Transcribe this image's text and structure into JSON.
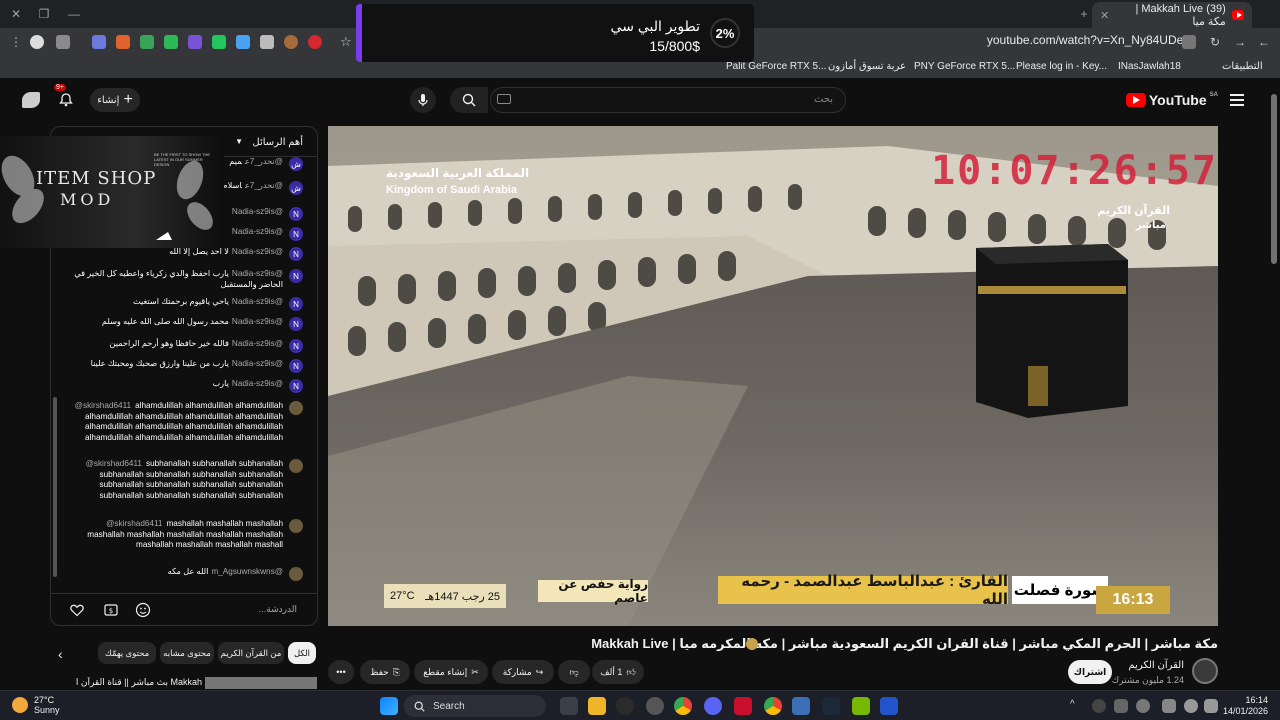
{
  "browser": {
    "tab_title": "(39) Makkah Live | مكة ميا",
    "url": "youtube.com/watch?v=Xn_Ny84UDeg",
    "bookmarks": [
      "Palit GeForce RTX 5...",
      "عربة تسوق أمازون",
      "PNY GeForce RTX 5...",
      "Please log in - Key...",
      "INasJawlah18",
      "التطبيقات"
    ]
  },
  "goal_overlay": {
    "percent": "2%",
    "title": "تطوير البي سي",
    "amount": "15/800$"
  },
  "youtube": {
    "logo": "YouTube",
    "region": "SA",
    "search_placeholder": "بحث",
    "create_label": "إنشاء",
    "notifications": "9+"
  },
  "chat": {
    "header": "أهم الرسائل",
    "input_placeholder": "الدردشة...",
    "messages": [
      {
        "author": "@نحدر_7ع",
        "text": "ميم",
        "avatar": "ش"
      },
      {
        "author": "@نحدر_7ع",
        "text": "اسلام عليكم والمسلمات والمؤمنات",
        "avatar": "ش"
      },
      {
        "author": "@Nadia-sz9is",
        "text": "",
        "avatar": "N"
      },
      {
        "author": "@Nadia-sz9is",
        "text": "",
        "avatar": "N"
      },
      {
        "author": "@Nadia-sz9is",
        "text": "لا أحد يصل إلا الله",
        "avatar": "N"
      },
      {
        "author": "@Nadia-sz9is",
        "text": "يارب احفظ والدي زكرياء واعطيه كل الخير في الحاضر والمستقبل",
        "avatar": "N"
      },
      {
        "author": "@Nadia-sz9is",
        "text": "ياحي ياقيوم برحمتك استغيث",
        "avatar": "N"
      },
      {
        "author": "@Nadia-sz9is",
        "text": "محمد رسول الله صلى الله عليه وسلم",
        "avatar": "N"
      },
      {
        "author": "@Nadia-sz9is",
        "text": "فالله خير حافظا وهو أرحم الراحمين",
        "avatar": "N"
      },
      {
        "author": "@Nadia-sz9is",
        "text": "يارب من علينا وارزق صحبك ومحبتك علينا",
        "avatar": "N"
      },
      {
        "author": "@Nadia-sz9is",
        "text": "يارب",
        "avatar": "N"
      },
      {
        "author": "@skirshad6411",
        "text": "alhamdulillah alhamdulillah alhamdulillah alhamdulillah alhamdulillah alhamdulillah alhamdulillah alhamdulillah alhamdulillah alhamdulillah alhamdulillah alhamdulillah alhamdulillah alhamdulillah alhamdulillah",
        "avatar": ""
      },
      {
        "author": "@skirshad6411",
        "text": "subhanallah subhanallah subhanallah subhanallah subhanallah subhanallah subhanallah subhanallah subhanallah subhanallah subhanallah subhanallah subhanallah subhanallah subhanallah",
        "avatar": ""
      },
      {
        "author": "@skirshad6411",
        "text": "mashallah mashallah mashallah mashallah mashallah mashallah mashallah mashallah mashallah mashallah mashallah mashall",
        "avatar": ""
      },
      {
        "author": "@m_Agsuwnskwns",
        "text": "الله عل مكه",
        "avatar": ""
      }
    ]
  },
  "item_shop": {
    "line1": "ITEM SHOP",
    "line2": "MOD",
    "tiny": "BE THE FIRST TO SHOW THE LATEST IN OUR SUMMER DESIGN"
  },
  "video": {
    "channel_brand_ar": "المملكة العربية السعودية",
    "channel_brand_en": "Kingdom of Saudi Arabia",
    "clock": "10:07:26:57",
    "station_ar": "القرآن الكريم",
    "station_live": "مباشر",
    "surah": "سورة فصلت",
    "reciter": "القارئ : عبدالباسط عبدالصمد - رحمه الله",
    "riwaya": "رواية حفص عن عاصم",
    "date_hijri": "25 رجب 1447هـ",
    "temperature": "27°C",
    "time": "16:13"
  },
  "watch": {
    "title": "مكة مباشر | الحرم المكي مباشر | قناة القران الكريم السعودية مباشر | مكه المكرمه ميا | Makkah Live",
    "channel_name": "القرآن الكريم",
    "subscribers": "1.24 مليون مشترك",
    "subscribe_label": "اشتراك",
    "likes": "1 ألف",
    "share_label": "مشاركة",
    "clip_label": "إنشاء مقطع",
    "save_label": "حفظ",
    "chips": [
      "الكل",
      "من القرآن الكريم",
      "محتوى مشابه",
      "محتوى يهمّك"
    ],
    "rec_title": "Makkah بث مباشر || قناة القرآن الكريم"
  },
  "taskbar": {
    "temp": "27°C",
    "condition": "Sunny",
    "search": "Search",
    "time": "16:14",
    "date": "14/01/2026"
  },
  "colors": {
    "accent_red": "#ff0000",
    "clock_red": "#d4213a",
    "gold": "#e8c24a",
    "goal_purple": "#7a3cf0"
  }
}
